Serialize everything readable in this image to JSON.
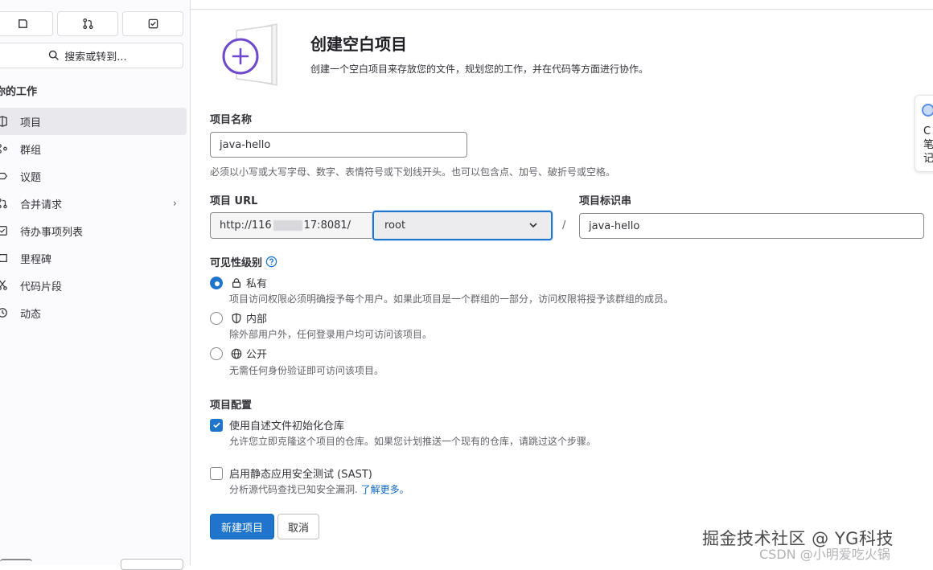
{
  "sidebar": {
    "search_label": "搜索或转到...",
    "section_heading": "你的工作",
    "items": [
      {
        "label": "项目",
        "icon": "project-icon",
        "active": true
      },
      {
        "label": "群组",
        "icon": "group-icon"
      },
      {
        "label": "议题",
        "icon": "issues-icon"
      },
      {
        "label": "合并请求",
        "icon": "merge-request-icon",
        "has_chevron": true
      },
      {
        "label": "待办事项列表",
        "icon": "todo-icon"
      },
      {
        "label": "里程碑",
        "icon": "milestone-icon"
      },
      {
        "label": "代码片段",
        "icon": "snippet-icon"
      },
      {
        "label": "动态",
        "icon": "activity-icon"
      }
    ],
    "chevron": "›"
  },
  "header": {
    "title": "创建空白项目",
    "description": "创建一个空白项目来存放您的文件，规划您的工作，并在代码等方面进行协作。"
  },
  "form": {
    "project_name_label": "项目名称",
    "project_name_value": "java-hello",
    "project_name_help": "必须以小写或大写字母、数字、表情符号或下划线开头。也可以包含点、加号、破折号或空格。",
    "url_label": "项目 URL",
    "url_prefix_start": "http://116",
    "url_prefix_end": "17:8081/",
    "namespace_value": "root",
    "slash": "/",
    "slug_label": "项目标识串",
    "slug_value": "java-hello",
    "visibility_label": "可见性级别",
    "visibility_options": [
      {
        "label": "私有",
        "desc": "项目访问权限必须明确授予每个用户。如果此项目是一个群组的一部分，访问权限将授予该群组的成员。",
        "checked": true,
        "icon": "lock-icon"
      },
      {
        "label": "内部",
        "desc": "除外部用户外，任何登录用户均可访问该项目。",
        "checked": false,
        "icon": "shield-icon"
      },
      {
        "label": "公开",
        "desc": "无需任何身份验证即可访问该项目。",
        "checked": false,
        "icon": "globe-icon"
      }
    ],
    "config_label": "项目配置",
    "readme_label": "使用自述文件初始化仓库",
    "readme_checked": true,
    "readme_desc": "允许您立即克隆这个项目的仓库。如果您计划推送一个现有的仓库，请跳过这个步骤。",
    "sast_label": "启用静态应用安全测试 (SAST)",
    "sast_checked": false,
    "sast_desc": "分析源代码查找已知安全漏洞.",
    "sast_link": "了解更多。",
    "submit_label": "新建项目",
    "cancel_label": "取消"
  },
  "side_widget": {
    "text": "C笔记"
  },
  "watermark": {
    "line1": "掘金技术社区 @ YG科技",
    "line2": "CSDN @小明爱吃火锅"
  },
  "colors": {
    "primary": "#1f75cb",
    "link": "#1068bf",
    "illustration_purple": "#6e49cb"
  }
}
